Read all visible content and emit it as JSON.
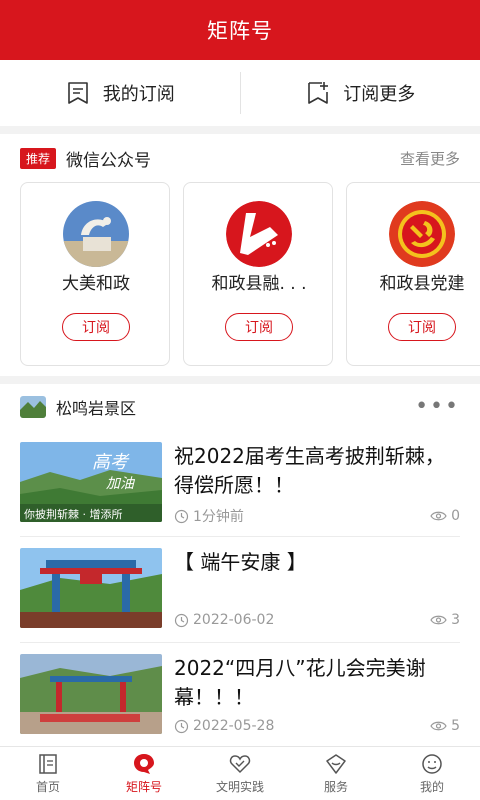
{
  "header": {
    "title": "矩阵号"
  },
  "subscribe_row": {
    "my_subs": "我的订阅",
    "more_subs": "订阅更多"
  },
  "wechat": {
    "tag": "推荐",
    "label": "微信公众号",
    "more": "查看更多",
    "accounts": [
      {
        "name": "大美和政",
        "button": "订阅"
      },
      {
        "name": "和政县融. . .",
        "button": "订阅"
      },
      {
        "name": "和政县党建",
        "button": "订阅"
      }
    ]
  },
  "feed": {
    "name": "松鸣岩景区",
    "more_icon": "more-dots-icon",
    "articles": [
      {
        "title": "祝2022届考生高考披荆斩棘，得偿所愿！！",
        "time": "1分钟前",
        "views": "0",
        "image_caption": "你披荆斩棘 · 增添所"
      },
      {
        "title": "【 端午安康 】",
        "time": "2022-06-02",
        "views": "3"
      },
      {
        "title": "2022“四月八”花儿会完美谢幕！！！",
        "time": "2022-05-28",
        "views": "5"
      }
    ]
  },
  "tabbar": {
    "tabs": [
      {
        "label": "首页",
        "icon": "home-icon"
      },
      {
        "label": "矩阵号",
        "icon": "matrix-icon"
      },
      {
        "label": "文明实践",
        "icon": "heart-icon"
      },
      {
        "label": "服务",
        "icon": "service-icon"
      },
      {
        "label": "我的",
        "icon": "profile-icon"
      }
    ],
    "active": "矩阵号"
  },
  "colors": {
    "accent": "#d7161d",
    "background_gap": "#f2f2f2"
  }
}
